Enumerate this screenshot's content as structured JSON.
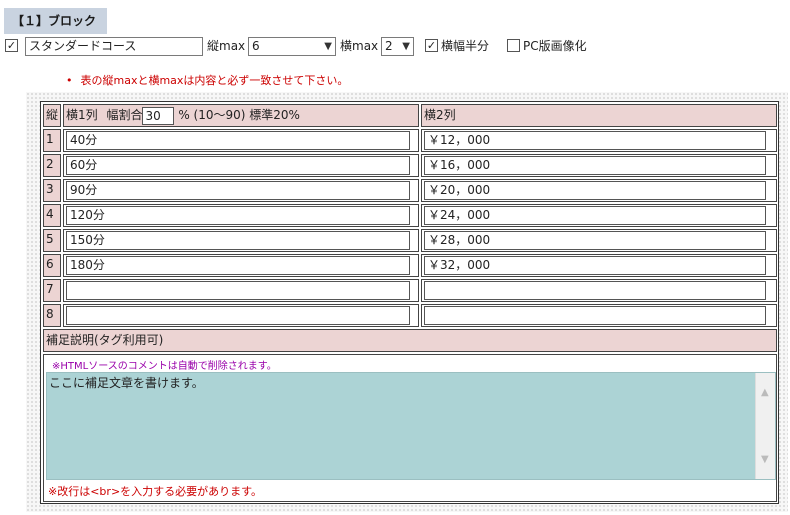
{
  "block": {
    "title": "【１】ブロック"
  },
  "config": {
    "enable_checked": "✓",
    "course_name": "スタンダードコース",
    "rows_label": "縦max",
    "rows_value": "6",
    "cols_label": "横max",
    "cols_value": "2",
    "half_width_checked": "✓",
    "half_width_label": "横幅半分",
    "pc_image_label": "PC版画像化"
  },
  "notice": {
    "bullet": "•",
    "text": "表の縦maxと横maxは内容と必ず一致させて下さい。"
  },
  "table": {
    "corner": "縦",
    "col1_header_prefix": "横1列",
    "col1_ratio_label": "幅割合",
    "col1_ratio_value": "30",
    "col1_ratio_suffix": "% (10〜90) 標準20%",
    "col2_header": "横2列",
    "rows": [
      {
        "num": "1",
        "col1": "40分",
        "col2": "￥12，000"
      },
      {
        "num": "2",
        "col1": "60分",
        "col2": "￥16，000"
      },
      {
        "num": "3",
        "col1": "90分",
        "col2": "￥20，000"
      },
      {
        "num": "4",
        "col1": "120分",
        "col2": "￥24，000"
      },
      {
        "num": "5",
        "col1": "150分",
        "col2": "￥28，000"
      },
      {
        "num": "6",
        "col1": "180分",
        "col2": "￥32，000"
      },
      {
        "num": "7",
        "col1": "",
        "col2": ""
      },
      {
        "num": "8",
        "col1": "",
        "col2": ""
      }
    ]
  },
  "supplement": {
    "header": "補足説明(タグ利用可)",
    "html_note": "※HTMLソースのコメントは自動で削除されます。",
    "text": "ここに補足文章を書けます。",
    "br_note": "※改行は<br>を入力する必要があります。"
  }
}
